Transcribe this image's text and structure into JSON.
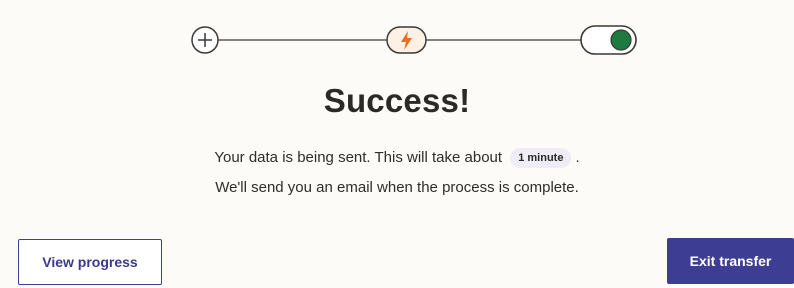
{
  "stepper": {
    "steps": [
      {
        "name": "add",
        "icon": "plus-icon"
      },
      {
        "name": "trigger",
        "icon": "lightning-bolt-icon",
        "color": "#f26a1b"
      },
      {
        "name": "toggle",
        "icon": "toggle-on-icon",
        "color": "#1f7a3f"
      }
    ]
  },
  "title": "Success!",
  "message": {
    "line1_prefix": "Your data is being sent. This will take about",
    "duration_chip": "1 minute",
    "line1_suffix": ".",
    "line2": "We'll send you an email when the process is complete."
  },
  "buttons": {
    "view_progress": "View progress",
    "exit_transfer": "Exit transfer"
  },
  "colors": {
    "primary": "#3d3d94",
    "background": "#fcfbf8",
    "accent_orange": "#f26a1b",
    "toggle_green": "#1f7a3f"
  }
}
